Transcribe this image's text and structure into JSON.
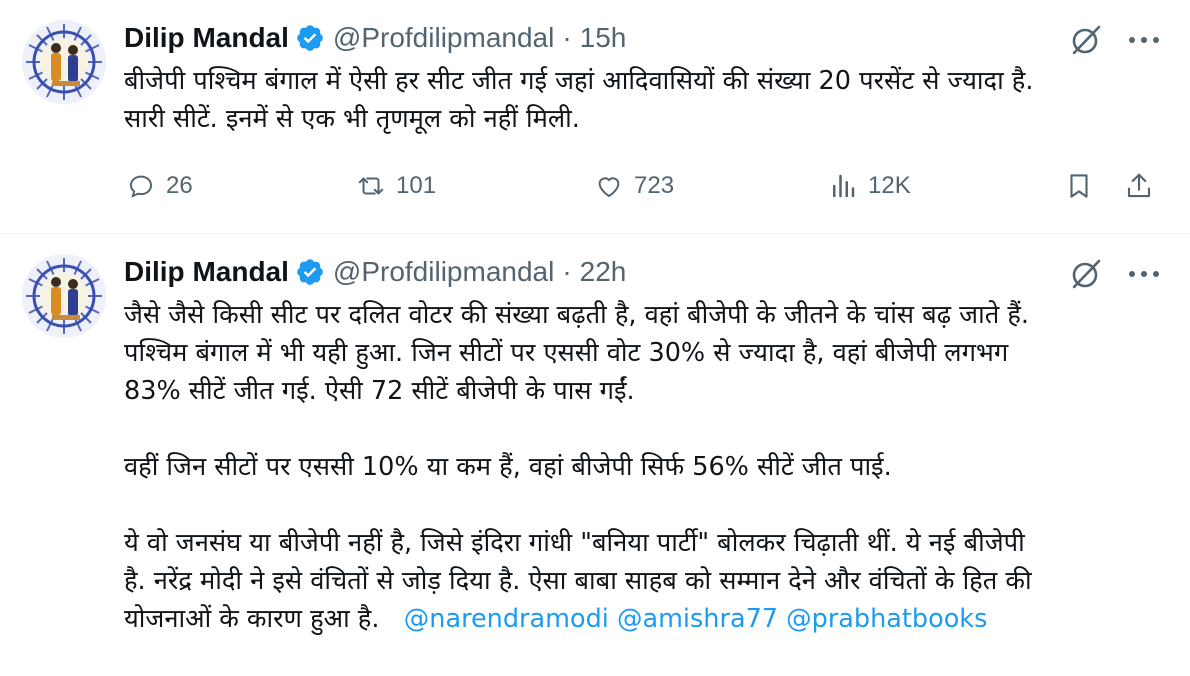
{
  "tweets": [
    {
      "author_name": "Dilip Mandal",
      "handle": "@Profdilipmandal",
      "separator": "·",
      "time": "15h",
      "lines": [
        "बीजेपी पश्चिम बंगाल में ऐसी हर सीट जीत गई जहां आदिवासियों की संख्या 20 परसेंट से ज्यादा है.",
        "सारी सीटें. इनमें से एक भी तृणमूल को नहीं मिली."
      ],
      "stats": {
        "replies": "26",
        "reposts": "101",
        "likes": "723",
        "views": "12K"
      }
    },
    {
      "author_name": "Dilip Mandal",
      "handle": "@Profdilipmandal",
      "separator": "·",
      "time": "22h",
      "lines": [
        "जैसे जैसे किसी सीट पर दलित वोटर की संख्या बढ़ती है, वहां बीजेपी के जीतने के चांस बढ़ जाते हैं.",
        "पश्चिम बंगाल में भी यही हुआ. जिन सीटों पर एससी वोट 30% से ज्यादा है, वहां बीजेपी लगभग",
        "83% सीटें जीत गई. ऐसी 72 सीटें बीजेपी के पास गईं.",
        "",
        "वहीं जिन सीटों पर एससी 10% या कम हैं, वहां बीजेपी सिर्फ 56% सीटें जीत पाई.",
        "",
        "ये वो जनसंघ या बीजेपी नहीं है, जिसे इंदिरा गांधी \"बनिया पार्टी\" बोलकर चिढ़ाती थीं. ये नई बीजेपी",
        "है. नरेंद्र मोदी ने इसे वंचितों से जोड़ दिया है. ऐसा बाबा साहब को सम्मान देने और वंचितों के हित की"
      ],
      "last_line_text": "योजनाओं के कारण हुआ है.",
      "mentions": [
        "@narendramodi",
        "@amishra77",
        "@prabhatbooks"
      ]
    }
  ],
  "colors": {
    "text": "#0f1419",
    "secondary": "#536471",
    "link": "#1d9bf0",
    "verified": "#1d9bf0",
    "divider": "#eff3f4"
  },
  "icons": {
    "reply": "speech-bubble-icon",
    "repost": "repost-arrows-icon",
    "like": "heart-icon",
    "views": "bar-chart-icon",
    "bookmark": "bookmark-icon",
    "share": "share-icon",
    "grok": "grok-icon",
    "more": "more-dots-icon"
  }
}
